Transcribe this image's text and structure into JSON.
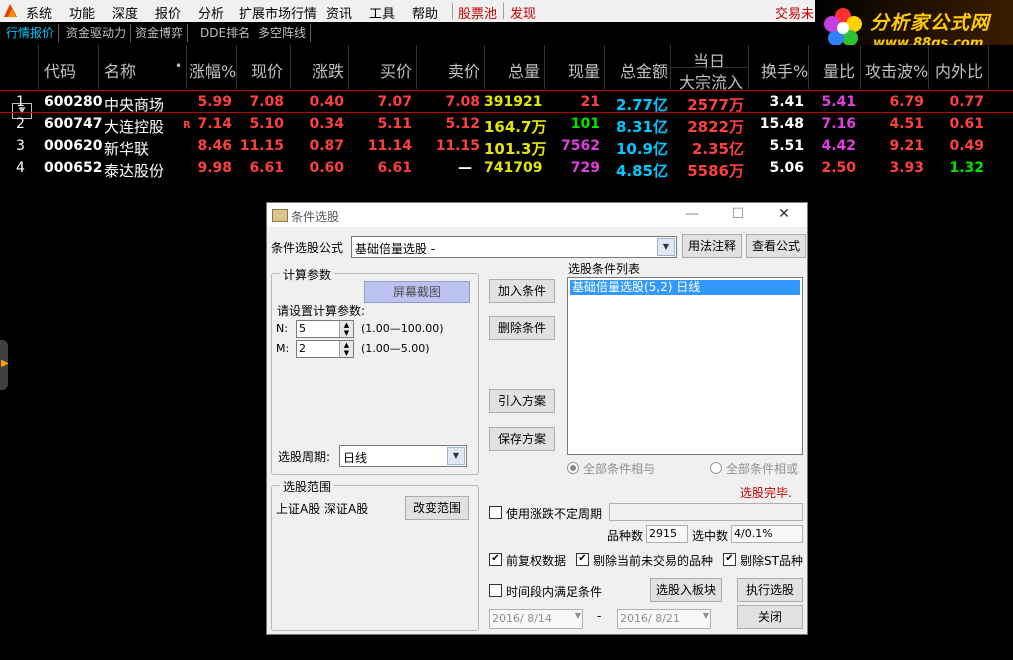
{
  "menu": {
    "items": [
      "系统",
      "功能",
      "深度",
      "报价",
      "分析",
      "扩展市场行情",
      "资讯",
      "工具",
      "帮助",
      "股票池",
      "发现"
    ],
    "trade": "交易未"
  },
  "brand": {
    "line1": "分析家公式网",
    "line2": "www.88gs.com"
  },
  "tabs": [
    "行情报价",
    "资金驱动力",
    "资金博弈",
    "DDE排名",
    "多空阵线"
  ],
  "table": {
    "headers": {
      "code": "代码",
      "name": "名称",
      "dot": "•",
      "change_pct": "涨幅%",
      "price": "现价",
      "change": "涨跌",
      "bid": "买价",
      "ask": "卖价",
      "volume": "总量",
      "cur_vol": "现量",
      "amount": "总金额",
      "today": "当日",
      "block_flow": "大宗流入",
      "turnover": "换手%",
      "vol_ratio": "量比",
      "attack": "攻击波%",
      "in_out": "内外比"
    },
    "rows": [
      {
        "idx": "1",
        "code": "600280",
        "name": "中央商场",
        "flag": "",
        "pct": "5.99",
        "price": "7.08",
        "chg": "0.40",
        "bid": "7.07",
        "ask": "7.08",
        "vol": "391921",
        "cur": "21",
        "amt": "2.77亿",
        "flow": "2577万",
        "turn": "3.41",
        "ratio": "5.41",
        "attack": "6.79",
        "inout": "0.77"
      },
      {
        "idx": "2",
        "code": "600747",
        "name": "大连控股",
        "flag": "R",
        "pct": "7.14",
        "price": "5.10",
        "chg": "0.34",
        "bid": "5.11",
        "ask": "5.12",
        "vol": "164.7万",
        "cur": "101",
        "amt": "8.31亿",
        "flow": "2822万",
        "turn": "15.48",
        "ratio": "7.16",
        "attack": "4.51",
        "inout": "0.61"
      },
      {
        "idx": "3",
        "code": "000620",
        "name": "新华联",
        "flag": "",
        "pct": "8.46",
        "price": "11.15",
        "chg": "0.87",
        "bid": "11.14",
        "ask": "11.15",
        "vol": "101.3万",
        "cur": "7562",
        "amt": "10.9亿",
        "flow": "2.35亿",
        "turn": "5.51",
        "ratio": "4.42",
        "attack": "9.21",
        "inout": "0.49"
      },
      {
        "idx": "4",
        "code": "000652",
        "name": "泰达股份",
        "flag": "",
        "pct": "9.98",
        "price": "6.61",
        "chg": "0.60",
        "bid": "6.61",
        "ask": "—",
        "vol": "741709",
        "cur": "729",
        "amt": "4.85亿",
        "flow": "5586万",
        "turn": "5.06",
        "ratio": "2.50",
        "attack": "3.93",
        "inout": "1.32"
      }
    ]
  },
  "dialog": {
    "title": "条件选股",
    "formula_label": "条件选股公式",
    "formula_value": "基础倍量选股 -",
    "usage_btn": "用法注释",
    "view_btn": "查看公式",
    "params_group": "计算参数",
    "params_prompt": "请设置计算参数:",
    "n_label": "N:",
    "n_value": "5",
    "n_range": "(1.00—100.00)",
    "m_label": "M:",
    "m_value": "2",
    "m_range": "(1.00—5.00)",
    "period_label": "选股周期:",
    "period_value": "日线",
    "add_btn": "加入条件",
    "del_btn": "删除条件",
    "import_btn": "引入方案",
    "save_btn": "保存方案",
    "list_label": "选股条件列表",
    "list_item": "基础倍量选股(5,2) 日线",
    "radio_and": "全部条件相与",
    "radio_or": "全部条件相或",
    "done": "选股完毕.",
    "scope_group": "选股范围",
    "scope_value": "上证A股 深证A股",
    "change_scope_btn": "改变范围",
    "uncertain_period": "使用涨跌不定周期",
    "count_label": "品种数",
    "count_value": "2915",
    "selected_label": "选中数",
    "selected_value": "4/0.1%",
    "pre_adjust": "前复权数据",
    "exclude_untraded": "剔除当前未交易的品种",
    "exclude_st": "剔除ST品种",
    "time_cond": "时间段内满足条件",
    "to_block_btn": "选股入板块",
    "exec_btn": "执行选股",
    "close_btn": "关闭",
    "date_from": "2016/ 8/14",
    "date_sep": "-",
    "date_to": "2016/ 8/21",
    "screenshot_overlay": "屏幕截图"
  }
}
